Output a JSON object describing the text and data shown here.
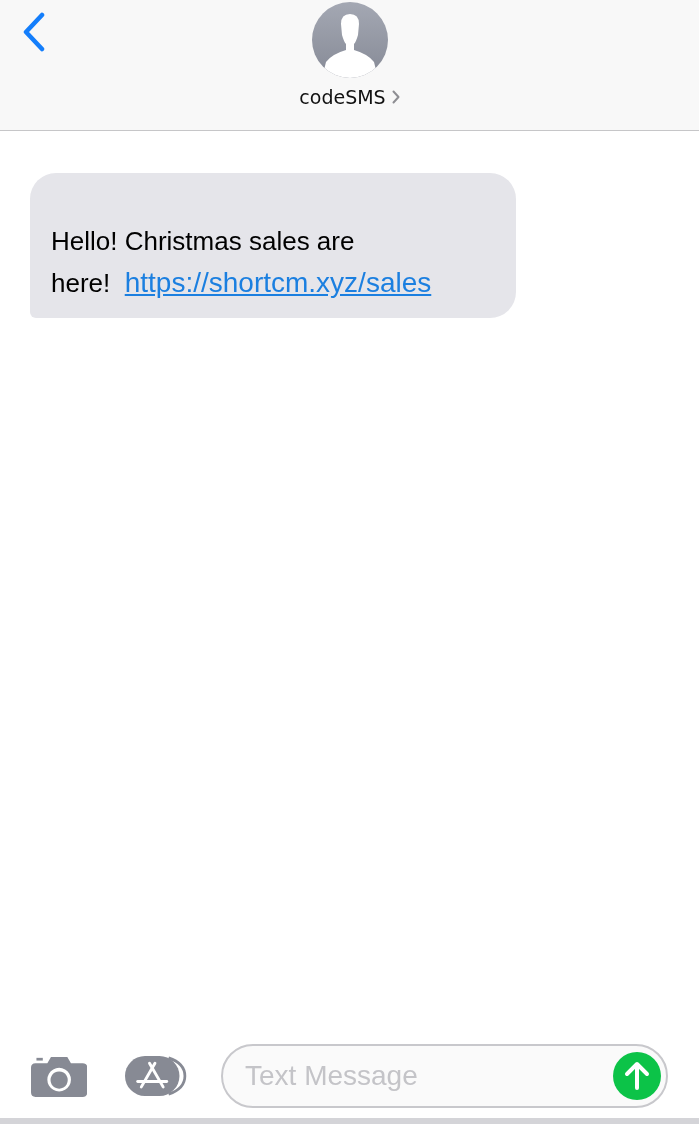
{
  "contact": {
    "name": "codeSMS"
  },
  "messages": [
    {
      "kind": "received",
      "text": "Hello! Christmas sales are here!",
      "link": "https://shortcm.xyz/sales"
    }
  ],
  "composer": {
    "placeholder": "Text Message"
  }
}
